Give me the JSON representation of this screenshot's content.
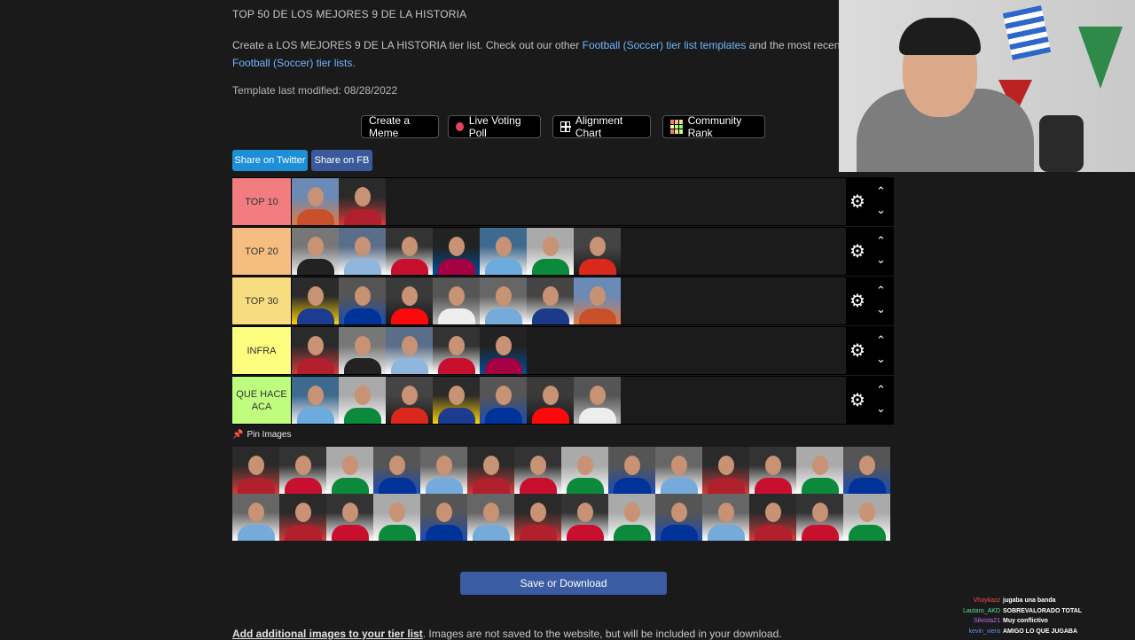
{
  "page": {
    "title": "TOP 50 DE LOS MEJORES 9 DE LA HISTORIA",
    "desc_part1": "Create a LOS MEJORES 9 DE LA HISTORIA tier list. Check out our other ",
    "desc_link1": "Football (Soccer) tier list templates",
    "desc_part2": " and the most recent user s",
    "desc_link2": "Football (Soccer) tier lists",
    "desc_part3": ".",
    "modified": "Template last modified: 08/28/2022"
  },
  "toolbar": {
    "meme": "Create a Meme",
    "poll": "Live Voting Poll",
    "alignment": "Alignment Chart",
    "community": "Community Rank"
  },
  "share": {
    "twitter": "Share on Twitter",
    "fb": "Share on FB"
  },
  "tiers": [
    {
      "label": "TOP 10",
      "color": "#f27c80",
      "count": 2
    },
    {
      "label": "TOP 20",
      "color": "#f5bd80",
      "count": 7
    },
    {
      "label": "TOP 30",
      "color": "#f8dd80",
      "count": 7
    },
    {
      "label": "INFRA",
      "color": "#fdfd7f",
      "count": 5
    },
    {
      "label": "QUE HACE ACA",
      "color": "#bffd7f",
      "count": 7
    }
  ],
  "pin_label": "Pin Images",
  "pool_count": 28,
  "save_label": "Save or Download",
  "footer": {
    "bold": "Add additional images to your tier list",
    "rest": ". Images are not saved to the website, but will be included in your download."
  },
  "chat": [
    {
      "user": "Vhoykazz",
      "msg": "jugaba una banda",
      "color": "#ff4b4b"
    },
    {
      "user": "Lautaro_AKD",
      "msg": "SOBREVALORADO TOTAL",
      "color": "#4ee3a6"
    },
    {
      "user": "Silvista21",
      "msg": "Muy conflictivo",
      "color": "#c46cff"
    },
    {
      "user": "kevin_viera",
      "msg": "AMIGO LO QUE JUGABA",
      "color": "#6b8cff"
    }
  ]
}
